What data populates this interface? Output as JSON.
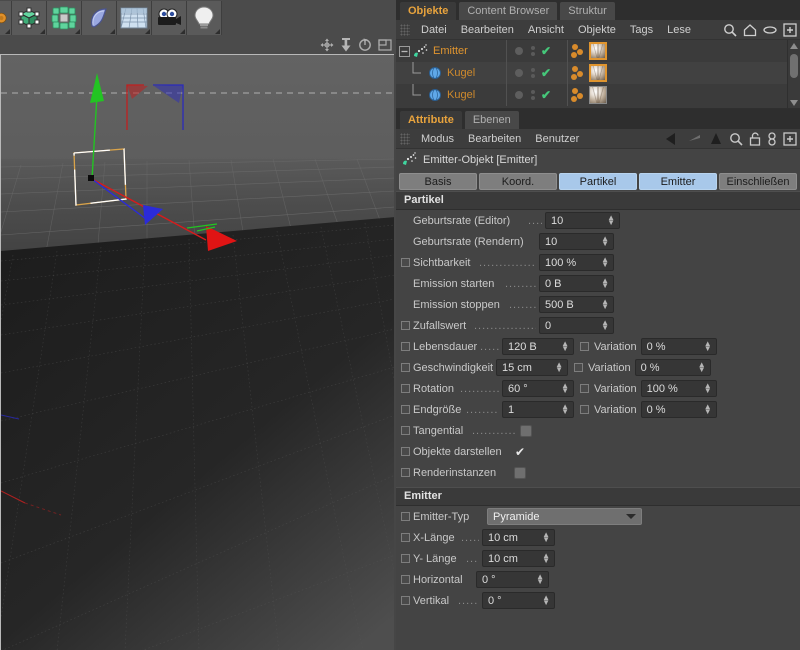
{
  "toolbar": {
    "buttons": [
      {
        "name": "undo-tool",
        "icon": "circle-orange-icon"
      },
      {
        "name": "cube-primitive-tool",
        "icon": "cube-icon"
      },
      {
        "name": "array-generator-tool",
        "icon": "array-icon"
      },
      {
        "name": "spline-tool",
        "icon": "spline-icon"
      },
      {
        "name": "floor-environment-tool",
        "icon": "floor-grid-icon"
      },
      {
        "name": "camera-tool",
        "icon": "camera-icon"
      },
      {
        "name": "light-tool",
        "icon": "lightbulb-icon"
      }
    ]
  },
  "viewport": {
    "header_icons": [
      "move-icon",
      "scale-icon",
      "rotate-icon",
      "panel-icon"
    ]
  },
  "object_manager": {
    "tabs": [
      {
        "label": "Objekte",
        "active": true
      },
      {
        "label": "Content Browser",
        "active": false
      },
      {
        "label": "Struktur",
        "active": false
      }
    ],
    "menu": [
      "Datei",
      "Bearbeiten",
      "Ansicht",
      "Objekte",
      "Tags",
      "Lese"
    ],
    "menu_icons": [
      "search-icon",
      "home-icon",
      "eye-icon",
      "plus-box-icon"
    ],
    "rows": [
      {
        "name": "Emitter",
        "level": 0,
        "icon": "emitter-icon",
        "has_material": true,
        "material_selected": true
      },
      {
        "name": "Kugel",
        "level": 1,
        "icon": "sphere-icon",
        "has_material": true,
        "material_selected": false
      },
      {
        "name": "Kugel",
        "level": 1,
        "icon": "sphere-icon",
        "has_material": true,
        "material_selected": false
      }
    ]
  },
  "attribute_manager": {
    "tabs": [
      {
        "label": "Attribute",
        "active": true
      },
      {
        "label": "Ebenen",
        "active": false
      }
    ],
    "menu": [
      "Modus",
      "Bearbeiten",
      "Benutzer"
    ],
    "menu_icons": [
      "back-arrow-icon",
      "forward-arrow-icon",
      "up-arrow-icon",
      "search-icon",
      "lock-icon",
      "link-icon",
      "plus-box-icon"
    ],
    "object_title": "Emitter-Objekt [Emitter]",
    "object_icon": "emitter-icon",
    "tabs_row": [
      {
        "label": "Basis",
        "active": false
      },
      {
        "label": "Koord.",
        "active": false
      },
      {
        "label": "Partikel",
        "active": true
      },
      {
        "label": "Emitter",
        "active": true
      },
      {
        "label": "Einschließen",
        "active": false
      }
    ],
    "sections": [
      {
        "title": "Partikel",
        "params": [
          {
            "label": "Geburtsrate (Editor)",
            "dots": "..",
            "type": "spinner",
            "value": "10",
            "keyframe": false
          },
          {
            "label": "Geburtsrate (Rendern)",
            "dots": "",
            "type": "spinner",
            "value": "10",
            "keyframe": false
          },
          {
            "label": "Sichtbarkeit",
            "dots": ".........",
            "type": "spinner",
            "value": "100 %",
            "keyframe": true
          },
          {
            "label": "Emission starten",
            "dots": ".....",
            "type": "spinner",
            "value": "0 B",
            "keyframe": false
          },
          {
            "label": "Emission stoppen",
            "dots": "....",
            "type": "spinner",
            "value": "500 B",
            "keyframe": false
          },
          {
            "label": "Zufallswert",
            "dots": ".........",
            "type": "spinner",
            "value": "0",
            "keyframe": true
          },
          {
            "label": "Lebensdauer",
            "dots": "...",
            "type": "spinner-variation",
            "value": "120 B",
            "variation_label": "Variation",
            "variation_value": "0 %",
            "keyframe": true
          },
          {
            "label": "Geschwindigkeit",
            "dots": "",
            "type": "spinner-variation",
            "value": "15 cm",
            "variation_label": "Variation",
            "variation_value": "0 %",
            "keyframe": true
          },
          {
            "label": "Rotation",
            "dots": ".......",
            "type": "spinner-variation",
            "value": "60 °",
            "variation_label": "Variation",
            "variation_value": "100 %",
            "keyframe": true
          },
          {
            "label": "Endgröße",
            "dots": "......",
            "type": "spinner-variation",
            "value": "1",
            "variation_label": "Variation",
            "variation_value": "0 %",
            "keyframe": true
          },
          {
            "label": "Tangential",
            "dots": ".......",
            "type": "checkbox",
            "checked": false,
            "keyframe": true
          },
          {
            "label": "Objekte darstellen",
            "dots": "",
            "type": "checkbox",
            "checked": true,
            "keyframe": true
          },
          {
            "label": "Renderinstanzen",
            "dots": "",
            "type": "checkbox",
            "checked": false,
            "keyframe": true
          }
        ]
      },
      {
        "title": "Emitter",
        "params": [
          {
            "label": "Emitter-Typ",
            "dots": "",
            "type": "combo",
            "value": "Pyramide",
            "keyframe": true
          },
          {
            "label": "X-Länge",
            "dots": "...",
            "type": "spinner",
            "value": "10 cm",
            "keyframe": true
          },
          {
            "label": "Y- Länge",
            "dots": "..",
            "type": "spinner",
            "value": "10 cm",
            "keyframe": true
          },
          {
            "label": "Horizontal",
            "dots": "",
            "type": "spinner",
            "value": "0 °",
            "keyframe": true
          },
          {
            "label": "Vertikal",
            "dots": "....",
            "type": "spinner",
            "value": "0 °",
            "keyframe": true
          }
        ]
      }
    ]
  },
  "colors": {
    "accent_orange": "#e0952f",
    "tab_active_blue": "#a8c8ea",
    "check_green": "#45c87a",
    "panel_bg": "#444444"
  }
}
